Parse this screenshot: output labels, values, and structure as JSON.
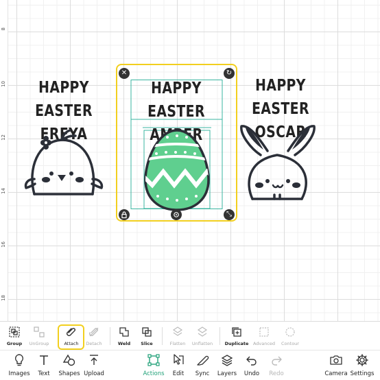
{
  "ruler": {
    "marks": [
      "8",
      "10",
      "12",
      "14",
      "16",
      "18"
    ]
  },
  "canvas": {
    "cards": [
      {
        "line1": "HAPPY EASTER",
        "line2": "FREYA",
        "graphic": "chick"
      },
      {
        "line1": "HAPPY EASTER",
        "line2": "AMBER",
        "graphic": "easter-egg"
      },
      {
        "line1": "HAPPY EASTER",
        "line2": "OSCAR",
        "graphic": "bunny"
      }
    ],
    "selection": {
      "handles": [
        "close-icon",
        "rotate-icon",
        "lock-icon",
        "menu-icon",
        "resize-icon"
      ]
    }
  },
  "colors": {
    "egg_fill": "#5fcf8f",
    "outline": "#2b2f38",
    "selection_border": "#f2cf1e",
    "guide_teal": "#3ab5a0",
    "active_green": "#21a179"
  },
  "toolbar1": {
    "group": "Group",
    "ungroup": "UnGroup",
    "attach": "Attach",
    "detach": "Detach",
    "weld": "Weld",
    "slice": "Slice",
    "flatten": "Flatten",
    "unflatten": "Unflatten",
    "duplicate": "Duplicate",
    "advanced": "Advanced",
    "contour": "Contour"
  },
  "toolbar2": {
    "images": "Images",
    "text": "Text",
    "shapes": "Shapes",
    "upload": "Upload",
    "actions": "Actions",
    "edit": "Edit",
    "sync": "Sync",
    "layers": "Layers",
    "undo": "Undo",
    "redo": "Redo",
    "camera": "Camera",
    "settings": "Settings"
  }
}
